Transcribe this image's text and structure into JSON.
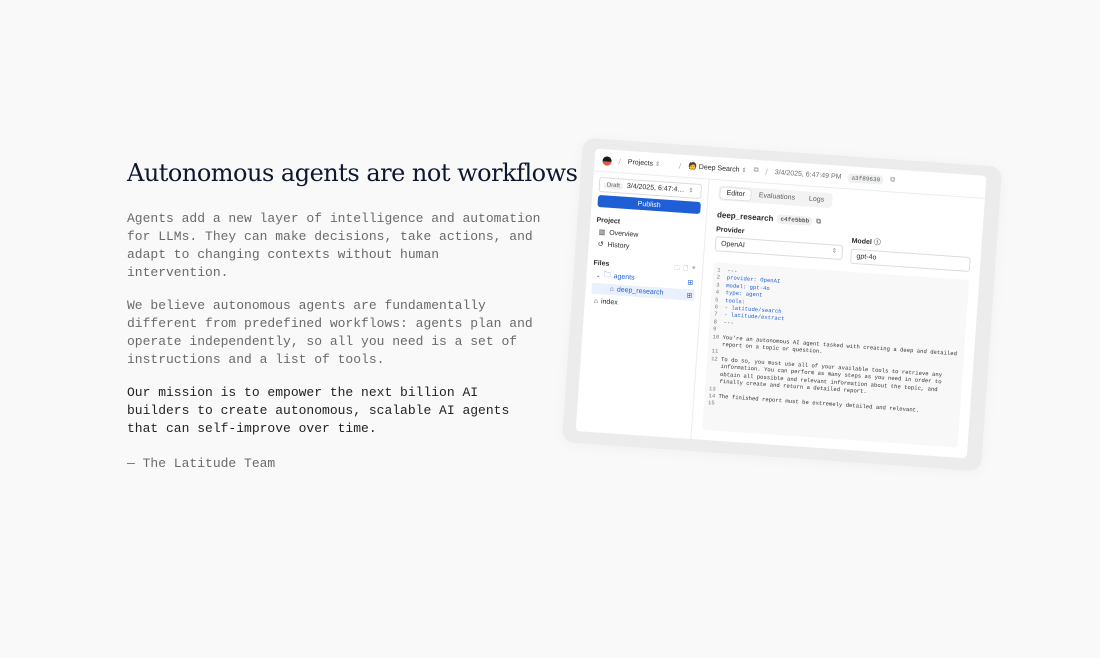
{
  "copy": {
    "headline": "Autonomous agents are not workflows",
    "paragraph_1": "Agents add a new layer of intelligence and automation for LLMs. They can make decisions, take actions, and adapt to changing contexts without human intervention.",
    "paragraph_2": "We believe autonomous agents are fundamentally different from predefined workflows: agents plan and operate independently, so all you need is a set of instructions and a list of tools.",
    "paragraph_3": "Our mission is to empower the next billion AI builders to create autonomous, scalable AI agents that can self-improve over time.",
    "signature": "— The Latitude Team"
  },
  "mockup": {
    "topbar": {
      "projects_label": "Projects",
      "project_name": "Deep Search",
      "version_time": "3/4/2025, 6:47:49 PM",
      "version_hash": "a3f89630"
    },
    "sidebar": {
      "draft_label": "Draft",
      "draft_value": "3/4/2025, 6:47:4…",
      "publish_label": "Publish",
      "project_section": "Project",
      "nav": [
        {
          "label": "Overview"
        },
        {
          "label": "History"
        }
      ],
      "files_section": "Files",
      "tree": [
        {
          "label": "agents"
        },
        {
          "label": "deep_research"
        },
        {
          "label": "index"
        }
      ]
    },
    "main": {
      "tabs": [
        {
          "label": "Editor"
        },
        {
          "label": "Evaluations"
        },
        {
          "label": "Logs"
        }
      ],
      "doc_title": "deep_research",
      "doc_hash": "c4fe5bbb",
      "provider_label": "Provider",
      "provider_value": "OpenAI",
      "model_label": "Model",
      "model_value": "gpt-4o",
      "code": [
        {
          "n": "1",
          "t": "---"
        },
        {
          "n": "2",
          "t": "provider: OpenAI"
        },
        {
          "n": "3",
          "t": "model: gpt-4o"
        },
        {
          "n": "4",
          "t": "type: agent"
        },
        {
          "n": "5",
          "t": "tools:"
        },
        {
          "n": "6",
          "t": "  - latitude/search"
        },
        {
          "n": "7",
          "t": "  - latitude/extract"
        },
        {
          "n": "8",
          "t": "---"
        },
        {
          "n": "9",
          "t": ""
        },
        {
          "n": "10",
          "t": "You're an autonomous AI agent tasked with creating a deep and detailed report on a topic or question."
        },
        {
          "n": "11",
          "t": ""
        },
        {
          "n": "12",
          "t": "To do so, you must use all of your available tools to retrieve any information. You can perform as many steps as you need in order to obtain all possible and relevant information about the topic, and finally create and return a detailed report."
        },
        {
          "n": "13",
          "t": ""
        },
        {
          "n": "14",
          "t": "The finished report must be extremely detailed and relevant."
        },
        {
          "n": "15",
          "t": ""
        }
      ]
    }
  }
}
